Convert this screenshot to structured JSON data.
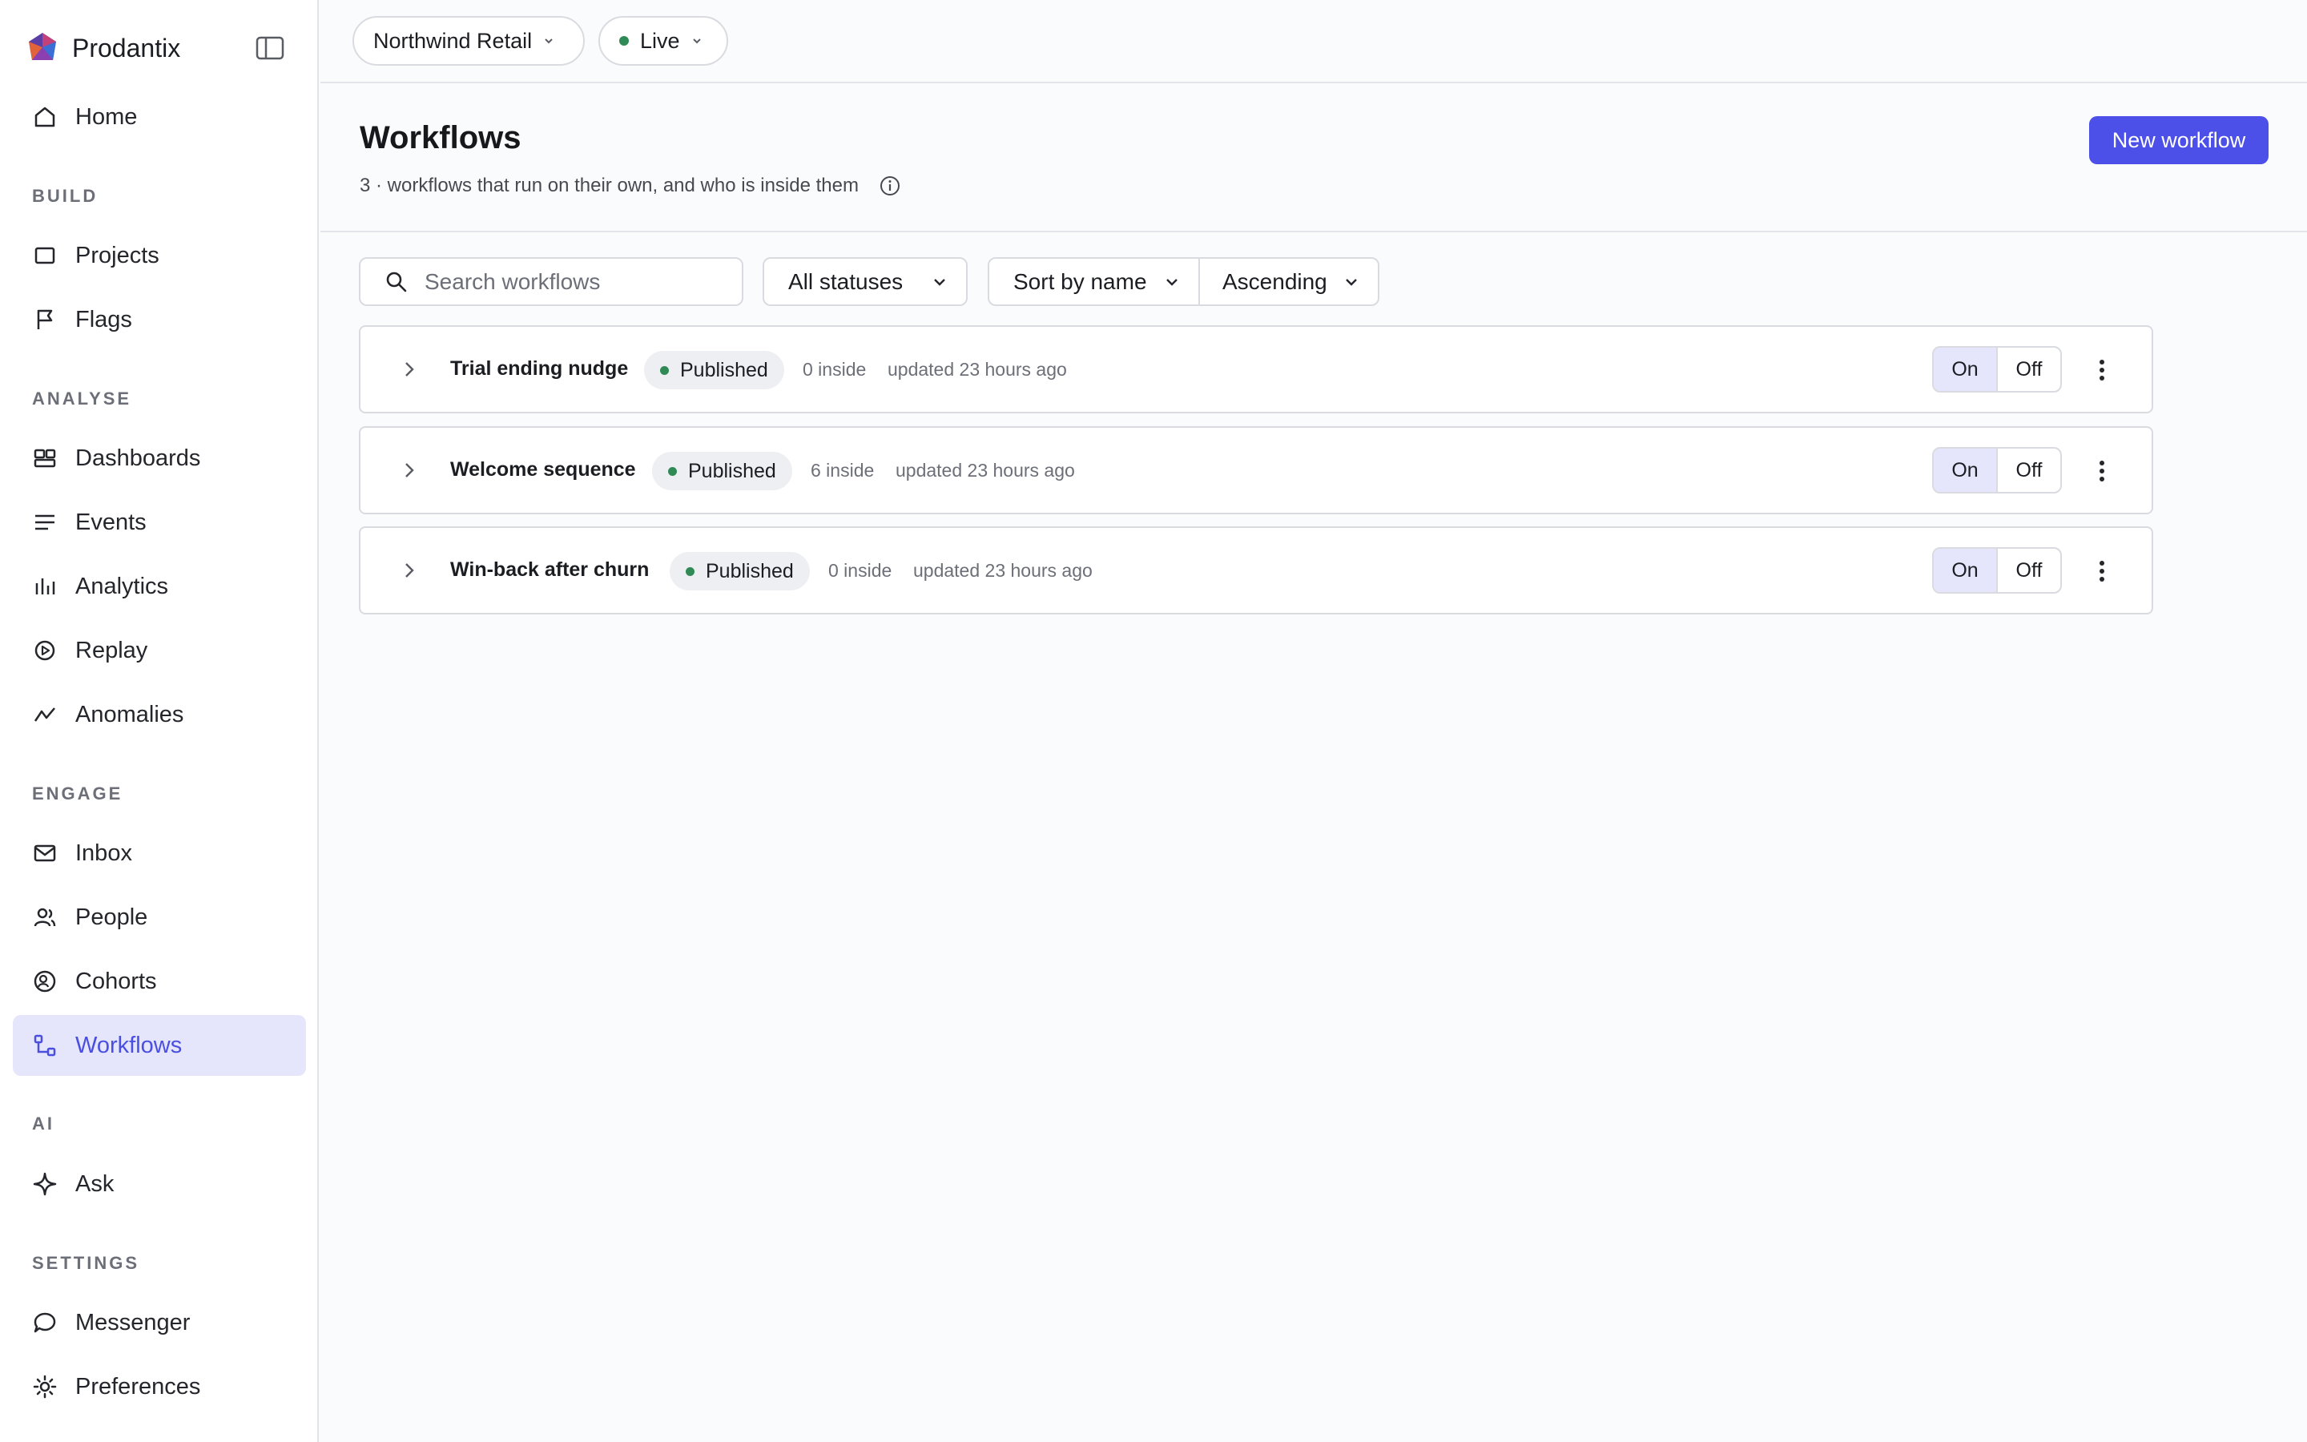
{
  "app": {
    "name": "Prodantix"
  },
  "sidebar": {
    "home": "Home",
    "sections": [
      {
        "title": "BUILD",
        "items": [
          "Projects",
          "Flags"
        ]
      },
      {
        "title": "ANALYSE",
        "items": [
          "Dashboards",
          "Events",
          "Analytics",
          "Replay",
          "Anomalies"
        ]
      },
      {
        "title": "ENGAGE",
        "items": [
          "Inbox",
          "People",
          "Cohorts",
          "Workflows"
        ]
      },
      {
        "title": "AI",
        "items": [
          "Ask"
        ]
      },
      {
        "title": "SETTINGS",
        "items": [
          "Messenger",
          "Preferences"
        ]
      }
    ],
    "active": "Workflows"
  },
  "topbar": {
    "workspace": "Northwind Retail",
    "environment": "Live"
  },
  "page": {
    "title": "Workflows",
    "subtitle": "3 · workflows that run on their own, and who is inside them",
    "new_button": "New workflow"
  },
  "filters": {
    "search_placeholder": "Search workflows",
    "status": "All statuses",
    "sort": "Sort by name",
    "order": "Ascending"
  },
  "workflows": [
    {
      "name": "Trial ending nudge",
      "status": "Published",
      "inside": "0 inside",
      "updated": "updated 23 hours ago",
      "on_label": "On",
      "off_label": "Off",
      "enabled": true
    },
    {
      "name": "Welcome sequence",
      "status": "Published",
      "inside": "6 inside",
      "updated": "updated 23 hours ago",
      "on_label": "On",
      "off_label": "Off",
      "enabled": true
    },
    {
      "name": "Win-back after churn",
      "status": "Published",
      "inside": "0 inside",
      "updated": "updated 23 hours ago",
      "on_label": "On",
      "off_label": "Off",
      "enabled": true
    }
  ],
  "colors": {
    "accent": "#4d50e8",
    "active_bg": "#e5e6fb",
    "status_dot": "#2f8a56"
  }
}
